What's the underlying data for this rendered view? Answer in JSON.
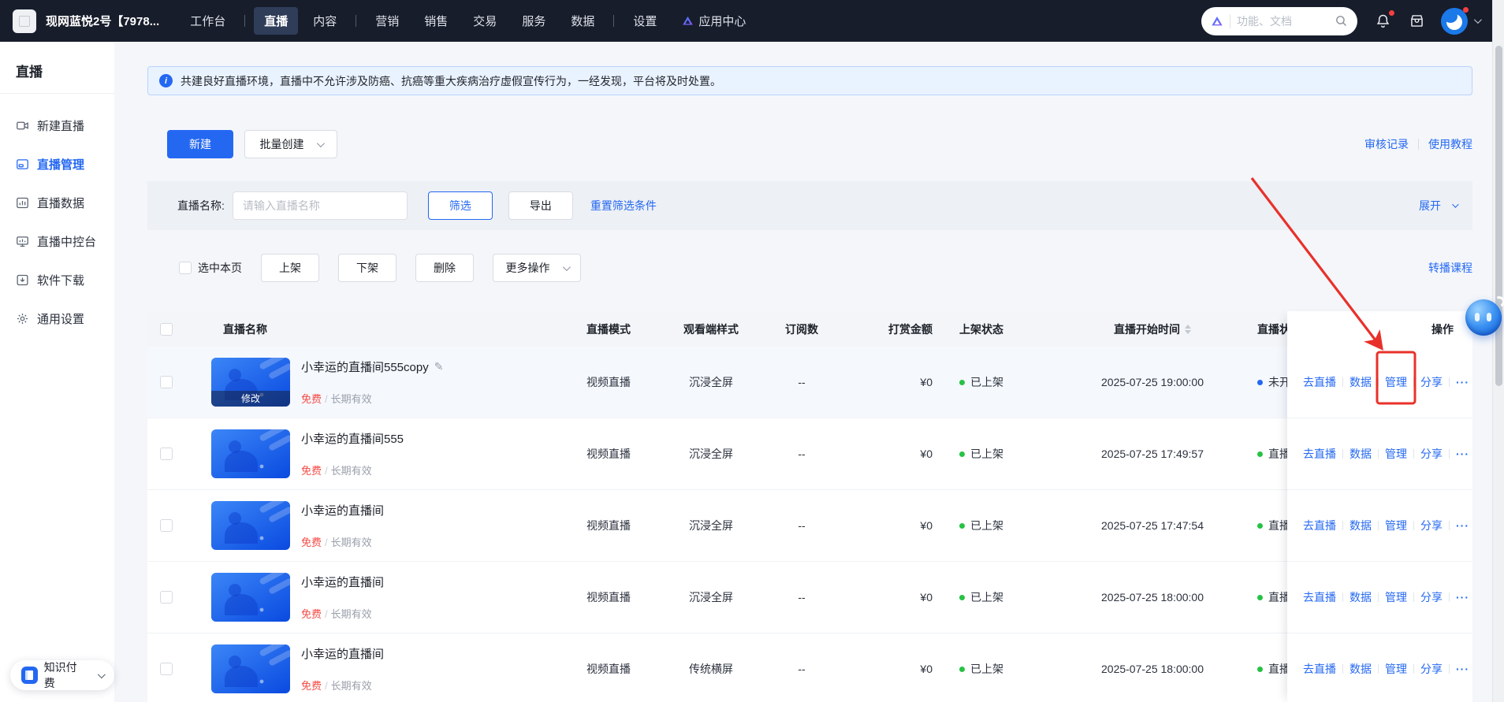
{
  "colors": {
    "accent": "#2468f2",
    "green_status": "#26c244",
    "blue_status": "#2468f2",
    "price_red": "#f54a45",
    "annotation_red": "#e8312a"
  },
  "topnav": {
    "workspace": "现网蓝悦2号【7978...",
    "items": [
      {
        "label": "工作台"
      },
      {
        "label": "直播",
        "active": true
      },
      {
        "label": "内容"
      },
      {
        "label": "营销"
      },
      {
        "label": "销售"
      },
      {
        "label": "交易"
      },
      {
        "label": "服务"
      },
      {
        "label": "数据"
      },
      {
        "label": "设置"
      },
      {
        "label": "应用中心",
        "icon": "app-center"
      }
    ],
    "separators_after": [
      0,
      2,
      7
    ],
    "search_placeholder": "功能、文档"
  },
  "sidebar": {
    "title": "直播",
    "items": [
      {
        "label": "新建直播"
      },
      {
        "label": "直播管理",
        "active": true
      },
      {
        "label": "直播数据"
      },
      {
        "label": "直播中控台"
      },
      {
        "label": "软件下载"
      },
      {
        "label": "通用设置"
      }
    ],
    "bottom_label": "知识付费"
  },
  "notice": {
    "text": "共建良好直播环境，直播中不允许涉及防癌、抗癌等重大疾病治疗虚假宣传行为，一经发现，平台将及时处置。"
  },
  "toolbar": {
    "create": "新建",
    "batch_create": "批量创建",
    "audit_log": "审核记录",
    "tutorial": "使用教程"
  },
  "filterbar": {
    "label": "直播名称:",
    "placeholder": "请输入直播名称",
    "filter": "筛选",
    "export": "导出",
    "reset": "重置筛选条件",
    "expand": "展开"
  },
  "bulkbar": {
    "select_page": "选中本页",
    "publish": "上架",
    "unpublish": "下架",
    "delete": "删除",
    "more": "更多操作",
    "relay": "转播课程"
  },
  "table": {
    "headers": [
      "直播名称",
      "直播模式",
      "观看端样式",
      "订阅数",
      "打赏金额",
      "上架状态",
      "直播开始时间",
      "直播状态"
    ],
    "actions_header": "操作",
    "actions": [
      "去直播",
      "数据",
      "管理",
      "分享"
    ],
    "more_label": "···",
    "meta_separator": "/",
    "rows": [
      {
        "name": "小幸运的直播间555copy",
        "editable": true,
        "thumb_overlay": "修改",
        "price": "免费",
        "validity": "长期有效",
        "mode": "视频直播",
        "style": "沉浸全屏",
        "subscribers": "--",
        "reward": "¥0",
        "shelf_status": "已上架",
        "start_time": "2025-07-25 19:00:00",
        "live_status": "未开",
        "live_dot": "blue",
        "highlighted": true
      },
      {
        "name": "小幸运的直播间555",
        "price": "免费",
        "validity": "长期有效",
        "mode": "视频直播",
        "style": "沉浸全屏",
        "subscribers": "--",
        "reward": "¥0",
        "shelf_status": "已上架",
        "start_time": "2025-07-25 17:49:57",
        "live_status": "直播",
        "live_dot": "green"
      },
      {
        "name": "小幸运的直播间",
        "price": "免费",
        "validity": "长期有效",
        "mode": "视频直播",
        "style": "沉浸全屏",
        "subscribers": "--",
        "reward": "¥0",
        "shelf_status": "已上架",
        "start_time": "2025-07-25 17:47:54",
        "live_status": "直播",
        "live_dot": "green"
      },
      {
        "name": "小幸运的直播间",
        "price": "免费",
        "validity": "长期有效",
        "mode": "视频直播",
        "style": "沉浸全屏",
        "subscribers": "--",
        "reward": "¥0",
        "shelf_status": "已上架",
        "start_time": "2025-07-25 18:00:00",
        "live_status": "直播",
        "live_dot": "green"
      },
      {
        "name": "小幸运的直播间",
        "price": "免费",
        "validity": "长期有效",
        "mode": "视频直播",
        "style": "传统横屏",
        "subscribers": "--",
        "reward": "¥0",
        "shelf_status": "已上架",
        "start_time": "2025-07-25 18:00:00",
        "live_status": "直播",
        "live_dot": "green"
      }
    ]
  }
}
